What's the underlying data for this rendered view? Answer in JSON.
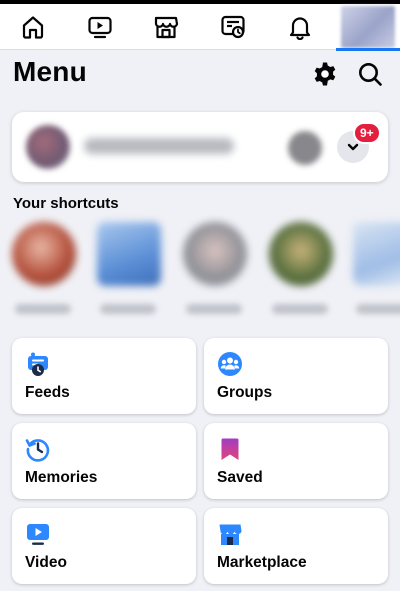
{
  "top_nav": {
    "tabs": [
      {
        "name": "home",
        "icon": "home-icon"
      },
      {
        "name": "video",
        "icon": "video-icon"
      },
      {
        "name": "marketplace",
        "icon": "marketplace-icon"
      },
      {
        "name": "feeds",
        "icon": "feeds-icon"
      },
      {
        "name": "notifications",
        "icon": "bell-icon"
      },
      {
        "name": "menu",
        "icon": "profile-thumbnail",
        "active": true
      }
    ],
    "active_color": "#1877f2"
  },
  "header": {
    "title": "Menu",
    "settings_icon": "gear-icon",
    "search_icon": "search-icon"
  },
  "profile_card": {
    "badge": "9+",
    "badge_color": "#e41e3f",
    "chevron_icon": "chevron-down-icon"
  },
  "shortcuts": {
    "title": "Your shortcuts"
  },
  "tiles": [
    {
      "label": "Feeds",
      "icon": "feeds-clock-icon"
    },
    {
      "label": "Groups",
      "icon": "groups-icon"
    },
    {
      "label": "Memories",
      "icon": "memories-icon"
    },
    {
      "label": "Saved",
      "icon": "bookmark-icon"
    },
    {
      "label": "Video",
      "icon": "video-play-icon"
    },
    {
      "label": "Marketplace",
      "icon": "shop-icon"
    }
  ]
}
